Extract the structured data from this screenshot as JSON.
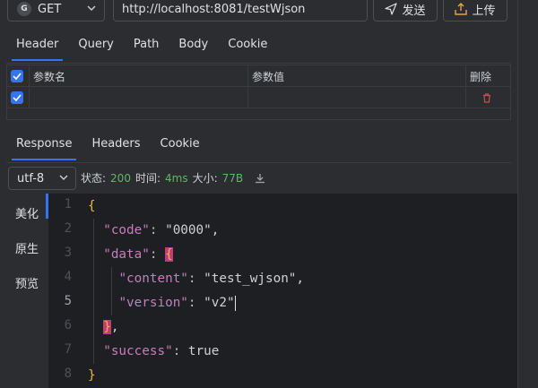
{
  "request": {
    "method": "GET",
    "method_icon": "G",
    "url": "http://localhost:8081/testWjson",
    "send_label": "发送",
    "upload_label": "上传",
    "tabs": [
      "Header",
      "Query",
      "Path",
      "Body",
      "Cookie"
    ],
    "active_tab": "Header"
  },
  "header_table": {
    "columns": [
      "参数名",
      "参数值",
      "删除"
    ],
    "rows": [
      {
        "name": "",
        "value": "",
        "checked": true
      }
    ]
  },
  "response": {
    "tabs": [
      "Response",
      "Headers",
      "Cookie"
    ],
    "active_tab": "Response",
    "encoding": "utf-8",
    "status_label": "状态:",
    "status_value": "200",
    "time_label": "时间:",
    "time_value": "4ms",
    "size_label": "大小:",
    "size_value": "77B",
    "view_modes": [
      "美化",
      "原生",
      "预览"
    ],
    "active_view": "美化"
  },
  "editor": {
    "line_numbers": [
      "1",
      "2",
      "3",
      "4",
      "5",
      "6",
      "7",
      "8"
    ],
    "current_line": "5",
    "lines": [
      "{",
      "  \"code\": \"0000\",",
      "  \"data\": {",
      "    \"content\": \"test_wjson\",",
      "    \"version\": \"v2\"",
      "  },",
      "  \"success\": true",
      "}"
    ]
  },
  "colors": {
    "accent": "#3574f0",
    "status_green": "#5fb865",
    "delete_red": "#c94f4f",
    "bracket_highlight": "#c33c7a"
  },
  "icons": {
    "method": "circle-g-icon",
    "send": "paper-plane-icon",
    "upload": "upload-icon",
    "download": "download-icon",
    "delete": "trash-icon"
  }
}
